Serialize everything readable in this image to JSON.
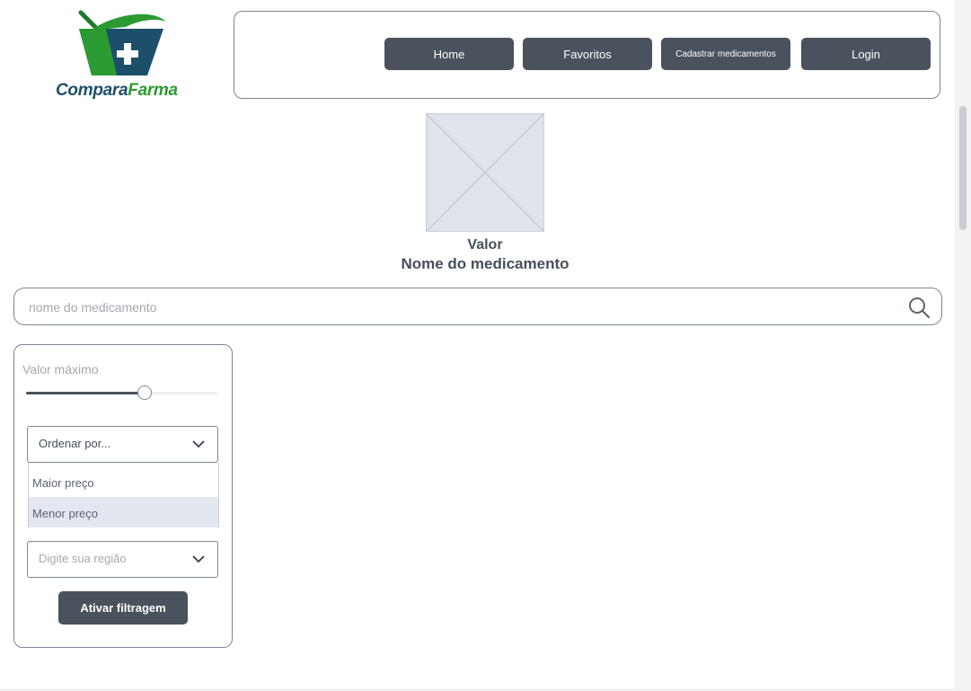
{
  "brand": {
    "name_part1": "Compara",
    "name_part2": "Farma"
  },
  "nav": {
    "items": [
      {
        "label": "Home"
      },
      {
        "label": "Favoritos"
      },
      {
        "label": "Cadastrar medicamentos"
      },
      {
        "label": "Login"
      }
    ]
  },
  "product": {
    "image_icon": "image-placeholder-icon",
    "price_label": "Valor",
    "name_label": "Nome do medicamento"
  },
  "search": {
    "placeholder": "nome do medicamento",
    "value": "",
    "icon": "search-icon"
  },
  "filters": {
    "slider_label": "Valor máximo",
    "slider_value_fraction": 0.62,
    "sort_select": {
      "value": "Ordenar por...",
      "options": [
        "Maior preço",
        "Menor preço"
      ],
      "highlighted": "Menor preço"
    },
    "region_select": {
      "placeholder": "Digite sua região"
    },
    "apply_button": "Ativar filtragem"
  },
  "colors": {
    "button_bg": "#4a525d",
    "border": "#7c8592",
    "placeholder_text": "#a3a9b1",
    "highlight": "#e3e7ef",
    "brand_green": "#2c9a33",
    "brand_blue": "#1d4f6b"
  }
}
